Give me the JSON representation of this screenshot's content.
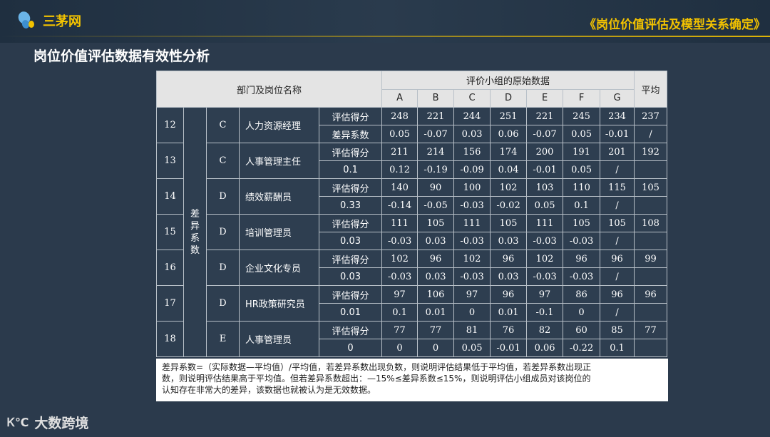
{
  "header": {
    "brand": "三茅网",
    "title": "《岗位价值评估及模型关系确定》"
  },
  "page_title": "岗位价值评估数据有效性分析",
  "table": {
    "dept_header": "部门及岗位名称",
    "group_header": "评价小组的原始数据",
    "avg_header": "平均",
    "cols": [
      "A",
      "B",
      "C",
      "D",
      "E",
      "F",
      "G"
    ],
    "side_label": "差异系数",
    "rows": [
      {
        "no": "12",
        "grade": "C",
        "name": "人力资源经理",
        "r1_label": "评估得分",
        "r1": [
          "248",
          "221",
          "244",
          "251",
          "221",
          "245",
          "234"
        ],
        "r1_avg": "237",
        "r2_label": "差异系数",
        "r2": [
          "0.05",
          "-0.07",
          "0.03",
          "0.06",
          "-0.07",
          "0.05",
          "-0.01"
        ],
        "r2_avg": "/"
      },
      {
        "no": "13",
        "grade": "C",
        "name": "人事管理主任",
        "r1_label": "评估得分",
        "r1": [
          "211",
          "214",
          "156",
          "174",
          "200",
          "191",
          "201"
        ],
        "r1_avg": "192",
        "r2_label": "0.1",
        "r2": [
          "0.12",
          "-0.19",
          "-0.09",
          "0.04",
          "-0.01",
          "0.05",
          "/"
        ],
        "r2_avg": ""
      },
      {
        "no": "14",
        "grade": "D",
        "name": "绩效薪酬员",
        "r1_label": "评估得分",
        "r1": [
          "140",
          "90",
          "100",
          "102",
          "103",
          "110",
          "115"
        ],
        "r1_avg": "105",
        "r2_label": "0.33",
        "r2": [
          "-0.14",
          "-0.05",
          "-0.03",
          "-0.02",
          "0.05",
          "0.1",
          "/"
        ],
        "r2_avg": ""
      },
      {
        "no": "15",
        "grade": "D",
        "name": "培训管理员",
        "r1_label": "评估得分",
        "r1": [
          "111",
          "105",
          "111",
          "105",
          "111",
          "105",
          "105"
        ],
        "r1_avg": "108",
        "r2_label": "0.03",
        "r2": [
          "-0.03",
          "0.03",
          "-0.03",
          "0.03",
          "-0.03",
          "-0.03",
          "/"
        ],
        "r2_avg": ""
      },
      {
        "no": "16",
        "grade": "D",
        "name": "企业文化专员",
        "r1_label": "评估得分",
        "r1": [
          "102",
          "96",
          "102",
          "96",
          "102",
          "96",
          "96"
        ],
        "r1_avg": "99",
        "r2_label": "0.03",
        "r2": [
          "-0.03",
          "0.03",
          "-0.03",
          "0.03",
          "-0.03",
          "-0.03",
          "/"
        ],
        "r2_avg": ""
      },
      {
        "no": "17",
        "grade": "D",
        "name": "HR政策研究员",
        "r1_label": "评估得分",
        "r1": [
          "97",
          "106",
          "97",
          "96",
          "97",
          "86",
          "96"
        ],
        "r1_avg": "96",
        "r2_label": "0.01",
        "r2": [
          "0.1",
          "0.01",
          "0",
          "0.01",
          "-0.1",
          "0",
          "/"
        ],
        "r2_avg": ""
      },
      {
        "no": "18",
        "grade": "E",
        "name": "人事管理员",
        "r1_label": "评估得分",
        "r1": [
          "77",
          "77",
          "81",
          "76",
          "82",
          "60",
          "85"
        ],
        "r1_avg": "77",
        "r2_label": "0",
        "r2": [
          "0",
          "0",
          "0.05",
          "-0.01",
          "0.06",
          "-0.22",
          "0.1"
        ],
        "r2_avg": ""
      }
    ]
  },
  "note": {
    "line1": "差异系数=（实际数据—平均值）/平均值，若差异系数出现负数，则说明评估结果低于平均值，若差异系数出现正",
    "line2": "数，则说明评估结果高于平均值。但若差异系数超出：—15%≤差异系数≤15%，则说明评估小组成员对该岗位的",
    "line3": "认知存在非常大的差异，该数据也就被认为是无效数据。"
  },
  "footer": {
    "mark": "Ꮶ℃",
    "brand": "大数跨境"
  },
  "colors": {
    "background": "#2b3a4c",
    "accent": "#f2c200",
    "header_cell": "#e4e4e4"
  }
}
